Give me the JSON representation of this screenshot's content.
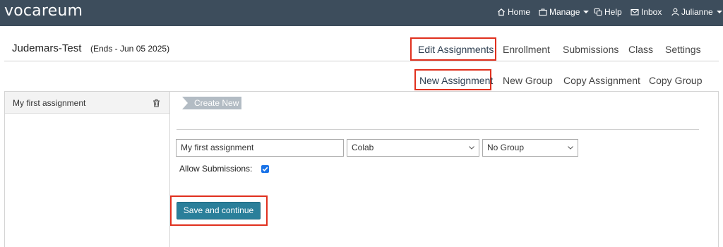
{
  "app": {
    "logo": "vocareum"
  },
  "topnav": {
    "home": "Home",
    "manage": "Manage",
    "help": "Help",
    "inbox": "Inbox",
    "user": "Julianne"
  },
  "course": {
    "name": "Judemars-Test",
    "ends": "(Ends - Jun 05 2025)"
  },
  "main_tabs": [
    "Edit Assignments",
    "Enrollment",
    "Submissions",
    "Class",
    "Settings"
  ],
  "sub_tabs": [
    "New Assignment",
    "New Group",
    "Copy Assignment",
    "Copy Group"
  ],
  "assignments": [
    {
      "label": "My first assignment"
    }
  ],
  "form": {
    "create_new": "Create New",
    "name_value": "My first assignment",
    "type_value": "Colab",
    "group_value": "No Group",
    "allow_submissions_label": "Allow Submissions:",
    "allow_submissions_checked": true,
    "save_label": "Save and continue"
  },
  "colors": {
    "topbar": "#3d4d5c",
    "highlight": "#e0301e",
    "save_button": "#2a7f9a",
    "checkbox": "#1a73e8"
  }
}
